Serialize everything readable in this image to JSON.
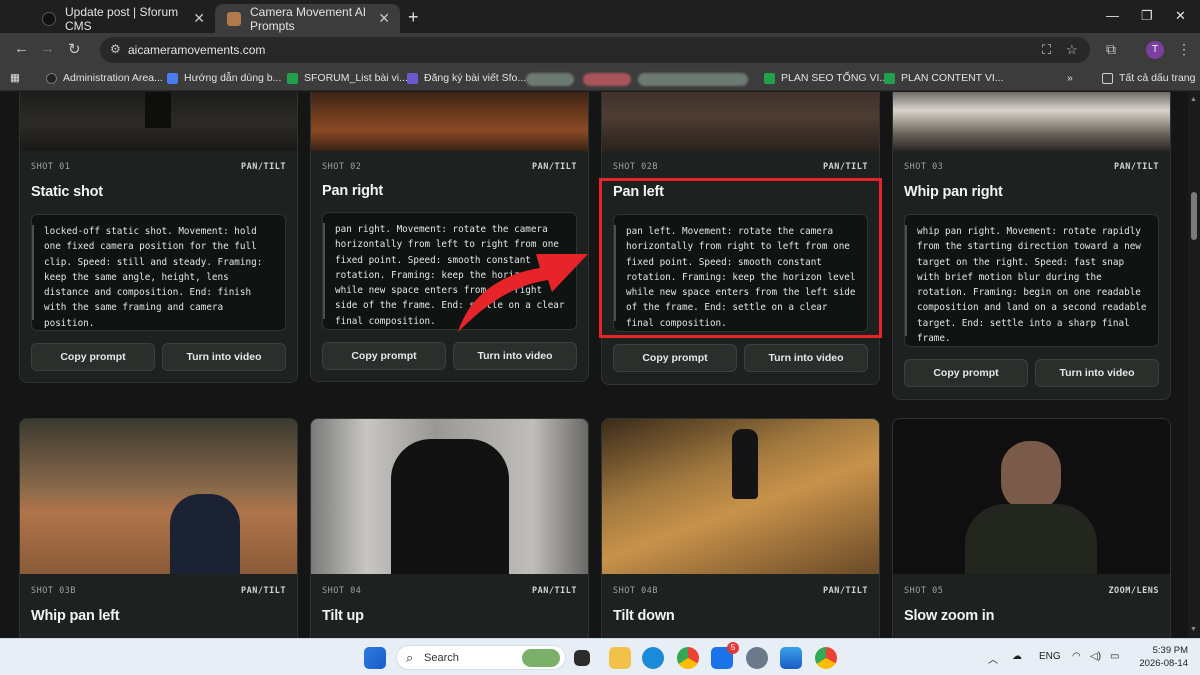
{
  "browser": {
    "tabs": [
      {
        "title": "Update post | Sforum CMS"
      },
      {
        "title": "Camera Movement AI Prompts"
      }
    ],
    "url": "aicameramovements.com",
    "profile_initial": "T",
    "bookmarks": [
      {
        "label": "Administration Area..."
      },
      {
        "label": "Hướng dẫn dùng b..."
      },
      {
        "label": "SFORUM_List bài vi..."
      },
      {
        "label": "Đăng ký bài viết Sfo..."
      },
      {
        "label": "PLAN SEO TỔNG VI..."
      },
      {
        "label": "PLAN CONTENT VI..."
      }
    ],
    "all_bookmarks": "Tất cả dấu trang",
    "more_bookmarks": "»"
  },
  "shots_row1": [
    {
      "code": "SHOT 01",
      "category": "PAN/TILT",
      "title": "Static shot",
      "prompt": "locked-off static shot. Movement: hold one fixed camera position for the full clip. Speed: still and steady. Framing: keep the same angle, height, lens distance and composition. End: finish with the same framing and camera position.",
      "copy_label": "Copy prompt",
      "video_label": "Turn into video"
    },
    {
      "code": "SHOT 02",
      "category": "PAN/TILT",
      "title": "Pan right",
      "prompt": "pan right. Movement: rotate the camera horizontally from left to right from one fixed point. Speed: smooth constant rotation. Framing: keep the horizon level while new space enters from the right side of the frame. End: settle on a clear final composition.",
      "copy_label": "Copy prompt",
      "video_label": "Turn into video"
    },
    {
      "code": "SHOT 02B",
      "category": "PAN/TILT",
      "title": "Pan left",
      "prompt": "pan left. Movement: rotate the camera horizontally from right to left from one fixed point. Speed: smooth constant rotation. Framing: keep the horizon level while new space enters from the left side of the frame. End: settle on a clear final composition.",
      "copy_label": "Copy prompt",
      "video_label": "Turn into video"
    },
    {
      "code": "SHOT 03",
      "category": "PAN/TILT",
      "title": "Whip pan right",
      "prompt": "whip pan right. Movement: rotate rapidly from the starting direction toward a new target on the right. Speed: fast snap with brief motion blur during the rotation. Framing: begin on one readable composition and land on a second readable target. End: settle into a sharp final frame.",
      "copy_label": "Copy prompt",
      "video_label": "Turn into video"
    }
  ],
  "shots_row2": [
    {
      "code": "SHOT 03B",
      "category": "PAN/TILT",
      "title": "Whip pan left"
    },
    {
      "code": "SHOT 04",
      "category": "PAN/TILT",
      "title": "Tilt up"
    },
    {
      "code": "SHOT 04B",
      "category": "PAN/TILT",
      "title": "Tilt down"
    },
    {
      "code": "SHOT 05",
      "category": "ZOOM/LENS",
      "title": "Slow zoom in"
    }
  ],
  "taskbar": {
    "search_placeholder": "Search",
    "language": "ENG",
    "time": "5:39 PM",
    "date": "2026-08-14",
    "zalo_badge": "5"
  },
  "colors": {
    "highlight": "#e8242b",
    "arrow": "#e8242b",
    "page_bg": "#151515",
    "card_bg": "#1d2220"
  }
}
